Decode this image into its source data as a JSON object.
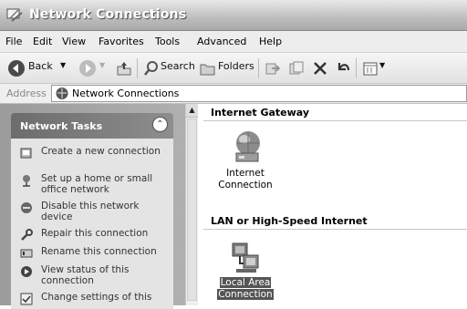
{
  "window": {
    "title": "Network Connections"
  },
  "menu": [
    "File",
    "Edit",
    "View",
    "Favorites",
    "Tools",
    "Advanced",
    "Help"
  ],
  "toolbar": {
    "back": "Back",
    "search": "Search",
    "folders": "Folders"
  },
  "address": {
    "label": "Address",
    "value": "Network Connections"
  },
  "tasks": {
    "title": "Network Tasks",
    "items": [
      "Create a new connection",
      "Set up a home or small office network",
      "Disable this network device",
      "Repair this connection",
      "Rename this connection",
      "View status of this connection",
      "Change settings of this"
    ]
  },
  "content": {
    "groups": [
      {
        "title": "Internet Gateway",
        "items": [
          {
            "line1": "Internet",
            "line2": "Connection",
            "icon": "internet-gateway-icon"
          }
        ]
      },
      {
        "title": "LAN or High-Speed Internet",
        "items": [
          {
            "line1": "Local Area",
            "line2": "Connection",
            "icon": "lan-connection-icon",
            "selected": true
          }
        ]
      }
    ]
  }
}
